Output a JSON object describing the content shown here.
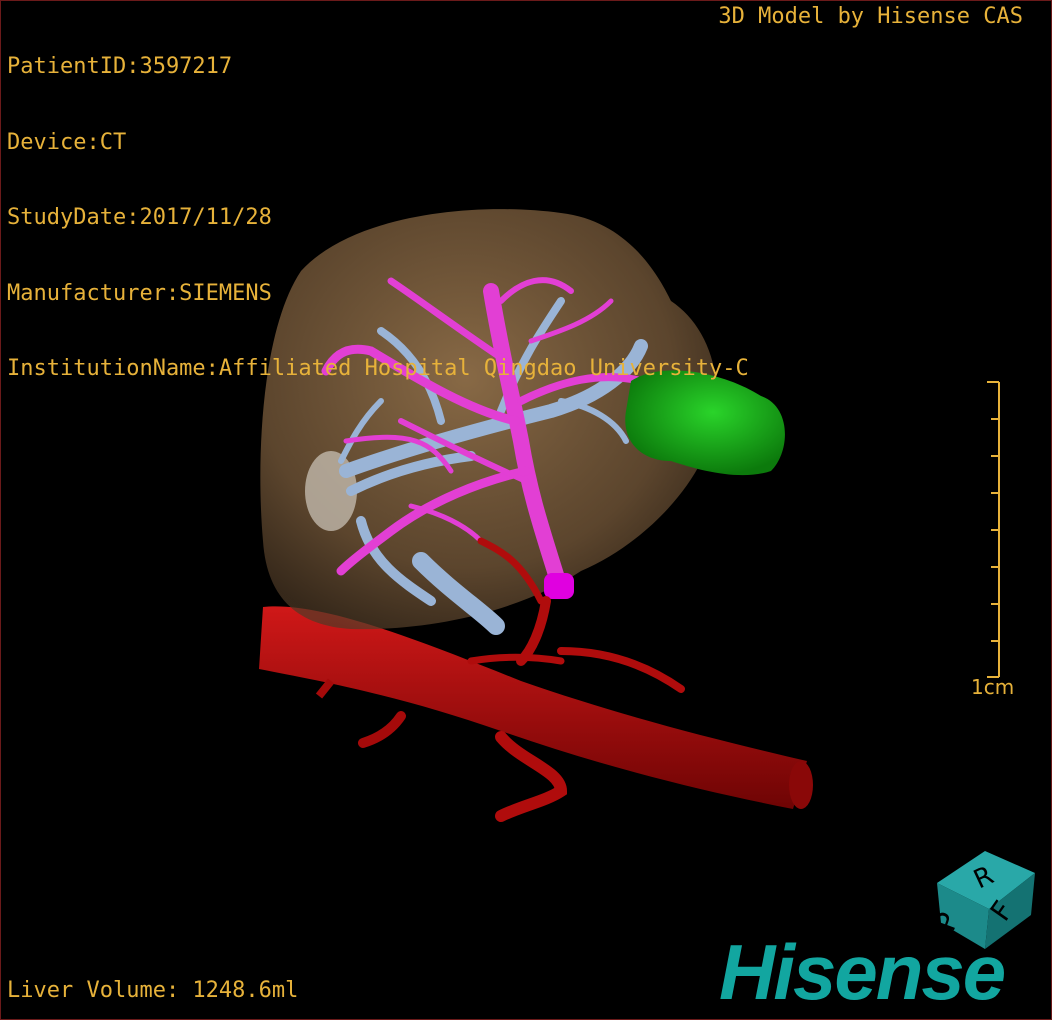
{
  "header": {
    "patient_id": "PatientID:3597217",
    "device": "Device:CT",
    "study_date": "StudyDate:2017/11/28",
    "manufacturer": "Manufacturer:SIEMENS",
    "institution": "InstitutionName:Affiliated Hospital Qingdao University-C"
  },
  "model_credit": "3D Model by Hisense CAS",
  "liver_volume": "Liver Volume: 1248.6ml",
  "scale": {
    "label": "1cm"
  },
  "orientation_cube": {
    "faces": [
      "R",
      "F",
      "P"
    ]
  },
  "logo": {
    "text": "Hisense"
  },
  "colors": {
    "overlay_text": "#e7b23a",
    "liver": "#8a6a45",
    "portal_vein": "#e23fd4",
    "hepatic_vein": "#9ab4d6",
    "artery_aorta": "#b00c0c",
    "tumor": "#19b419",
    "gallbladder": "#c8c0b4",
    "logo": "#12a6a0",
    "cube": "#1e8e8e"
  }
}
